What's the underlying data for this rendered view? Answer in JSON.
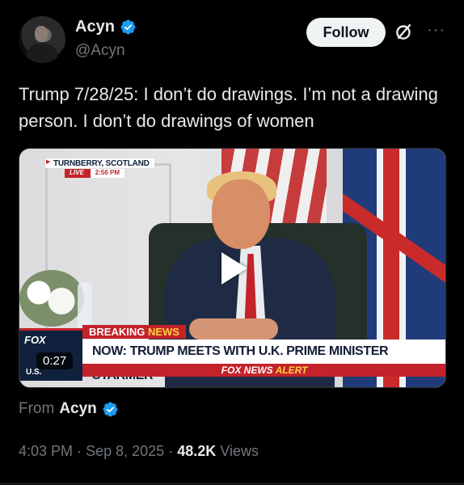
{
  "author": {
    "name": "Acyn",
    "handle": "@Acyn",
    "verified": true,
    "badge_color": "#1d9bf0"
  },
  "actions": {
    "follow_label": "Follow",
    "grok_icon": "grok-icon",
    "more_icon": "more-icon"
  },
  "tweet": {
    "text": "Trump 7/28/25: I don’t do drawings. I’m not a drawing person. I don’t do drawings of women"
  },
  "video": {
    "duration": "0:27",
    "location": "TURNBERRY, SCOTLAND",
    "live_label": "LIVE",
    "live_time": "2:56 PM",
    "breaking": "BREAKING",
    "breaking_news": "NEWS",
    "headline": "NOW: TRUMP MEETS WITH U.K. PRIME MINISTER STARMER",
    "alert_prefix": "FOX NEWS",
    "alert_word": "ALERT",
    "logo_text": "FOX",
    "logo_region": "U.S."
  },
  "from": {
    "label": "From",
    "name": "Acyn"
  },
  "meta": {
    "time": "4:03 PM",
    "sep1": "·",
    "date": "Sep 8, 2025",
    "sep2": "·",
    "views": "48.2K",
    "views_label": "Views"
  }
}
